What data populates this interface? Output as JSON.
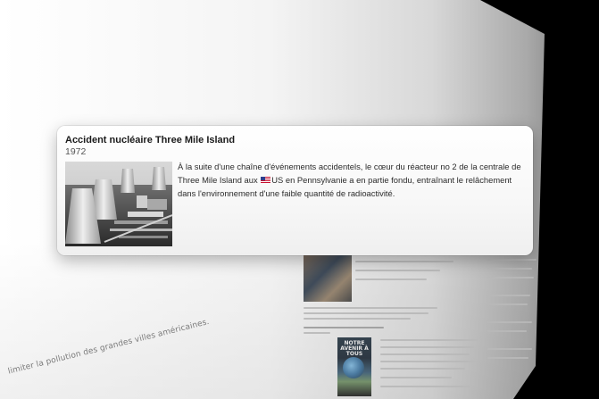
{
  "background": {
    "caption_fragment": "limiter la pollution des grandes villes américaines.",
    "book_title": "NOTRE AVENIR À TOUS"
  },
  "card": {
    "title": "Accident nucléaire Three Mile Island",
    "year": "1972",
    "image_icon": "nuclear-power-plant-photo",
    "text_before_flag": "À la suite d'une chaîne d'événements accidentels, le cœur du réacteur no 2 de la centrale de Three Mile Island aux ",
    "flag_icon": "us-flag-icon",
    "text_after_flag": "US en Pennsylvanie a en partie fondu, entraînant le relâchement dans l'environnement d'une faible quantité de radioactivité."
  },
  "colors": {
    "card_bg": "#f7f7f7",
    "wall_light": "#ffffff",
    "wall_dark": "#6a6a6a",
    "outside": "#000000"
  }
}
